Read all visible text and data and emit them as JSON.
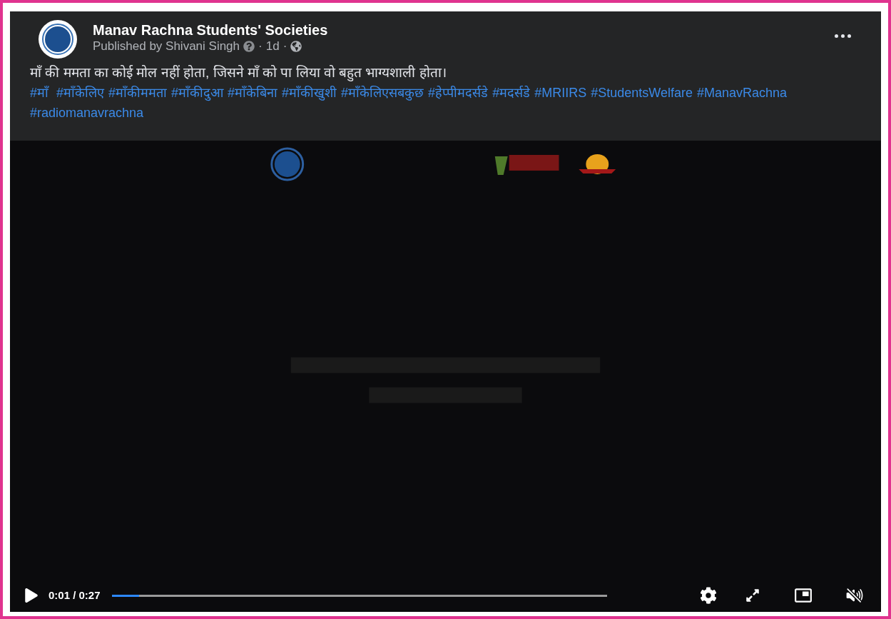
{
  "post": {
    "author": "Manav Rachna Students' Societies",
    "published_by": "Published by Shivani Singh",
    "separators": [
      "·",
      "·"
    ],
    "time": "1d",
    "text": "माँ की ममता का कोई मोल नहीं होता, जिसने माँ को पा लिया वो बहुत भाग्यशाली होता।",
    "hashtags": [
      "#माँ ",
      "#माँकेलिए",
      "#माँकीममता",
      "#माँकीदुआ",
      "#माँकेबिना",
      "#माँकीखुशी",
      "#माँकेलिएसबकुछ",
      "#हेप्पीमदर्सडे",
      "#मदर्सडे",
      "#MRIIRS",
      "#StudentsWelfare",
      "#ManavRachna",
      "#radiomanavrachna"
    ]
  },
  "video": {
    "kind": "picture",
    "elapsed": "0:01 / 0:27",
    "progress": {
      "level": 0.055
    },
    "muted": true
  }
}
